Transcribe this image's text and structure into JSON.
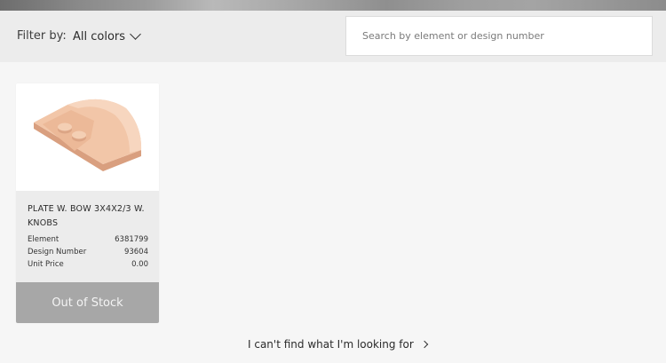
{
  "filter": {
    "label": "Filter by:",
    "selected": "All colors"
  },
  "search": {
    "placeholder": "Search by element or design number",
    "value": ""
  },
  "product": {
    "name": "PLATE W. BOW 3X4X2/3 W. KNOBS",
    "image_icon": "brick-image",
    "color": "#f0c2a4",
    "specs": [
      {
        "label": "Element",
        "value": "6381799"
      },
      {
        "label": "Design Number",
        "value": "93604"
      },
      {
        "label": "Unit Price",
        "value": "0.00"
      }
    ],
    "stock_status": "Out of Stock"
  },
  "help": {
    "link_text": "I can't find what I'm looking for"
  }
}
